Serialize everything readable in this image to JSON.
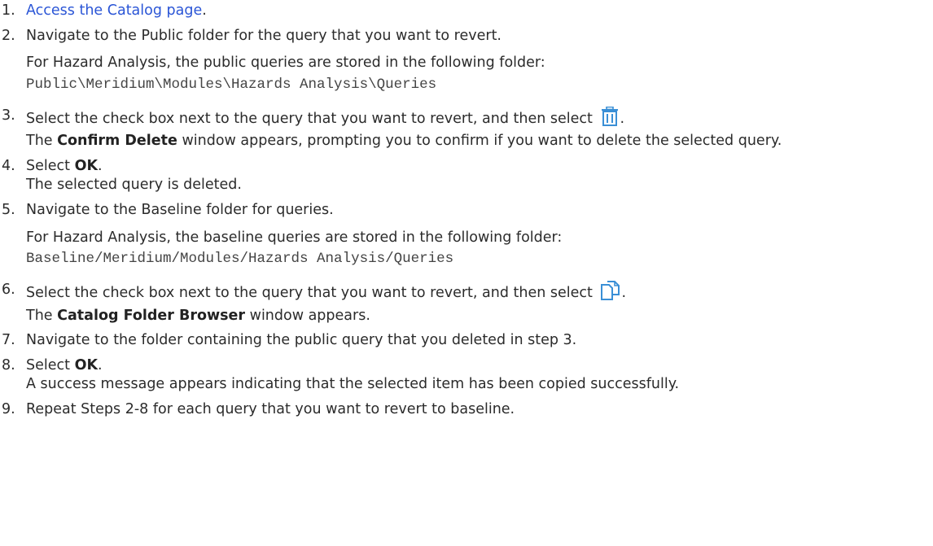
{
  "steps": [
    {
      "number": "1.",
      "link_text": "Access the Catalog page",
      "text_after": "."
    },
    {
      "number": "2.",
      "text": "Navigate to the Public folder for the query that you want to revert.",
      "note": "For Hazard Analysis, the public queries are stored in the following folder:",
      "path": "Public\\Meridium\\Modules\\Hazards Analysis\\Queries"
    },
    {
      "number": "3.",
      "text_before": "Select the check box next to the query that you want to revert, and then select",
      "text_after": ".",
      "icon": "delete-trash-icon",
      "result_before": "The ",
      "result_bold": "Confirm Delete",
      "result_after": " window appears, prompting you to confirm if you want to delete the selected query."
    },
    {
      "number": "4.",
      "text_before": "Select ",
      "bold": "OK",
      "text_after": ".",
      "result": "The selected query is deleted."
    },
    {
      "number": "5.",
      "text": "Navigate to the Baseline folder for queries.",
      "note": "For Hazard Analysis, the baseline queries are stored in the following folder:",
      "path": "Baseline/Meridium/Modules/Hazards Analysis/Queries"
    },
    {
      "number": "6.",
      "text_before": "Select the check box next to the query that you want to revert, and then select",
      "text_after": ".",
      "icon": "copy-icon",
      "result_before": "The ",
      "result_bold": "Catalog Folder Browser",
      "result_after": " window appears."
    },
    {
      "number": "7.",
      "text": "Navigate to the folder containing the public query that you deleted in step 3."
    },
    {
      "number": "8.",
      "text_before": "Select ",
      "bold": "OK",
      "text_after": ".",
      "result": "A success message appears indicating that the selected item has been copied successfully."
    },
    {
      "number": "9.",
      "text": "Repeat Steps 2-8 for each query that you want to revert to baseline."
    }
  ],
  "colors": {
    "link": "#2a55d6",
    "icon": "#3a8fd6",
    "text": "#2b2b2b"
  }
}
